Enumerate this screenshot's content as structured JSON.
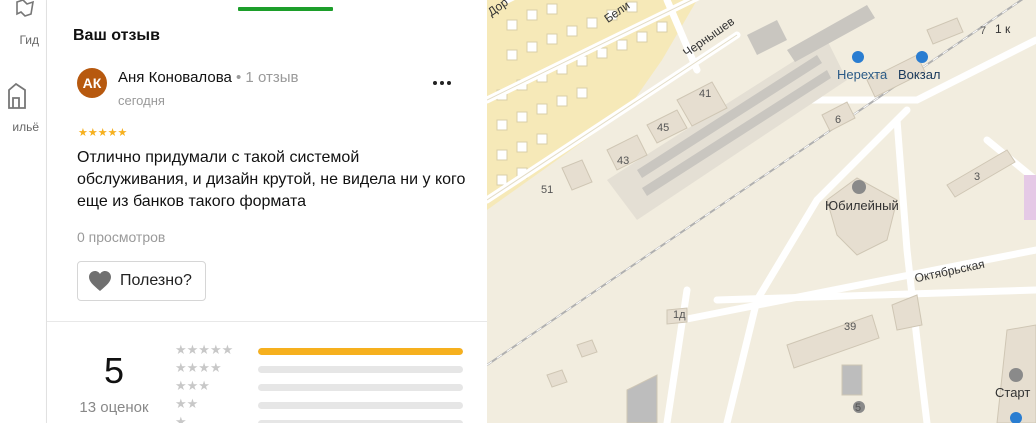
{
  "rail": {
    "items": [
      {
        "label": "Гид",
        "icon": "guide-icon"
      },
      {
        "label": "ильё",
        "icon": "housing-icon"
      }
    ]
  },
  "review": {
    "section_title": "Ваш отзыв",
    "avatar_initials": "АК",
    "avatar_color": "#b7590f",
    "author_name": "Аня Коновалова",
    "author_meta": " • 1 отзыв",
    "date": "сегодня",
    "stars": "★★★★★",
    "rating": 5,
    "text": "Отлично придумали с такой системой обслуживания, и дизайн крутой, не видела ни у кого еще из банков такого формата",
    "views": "0 просмотров",
    "helpful_label": "Полезно?",
    "menu_icon": "more-dots-icon"
  },
  "summary": {
    "average": "5",
    "count": "13 оценок",
    "distribution": [
      {
        "stars": "★★★★★",
        "fraction": 1.0
      },
      {
        "stars": "★★★★",
        "fraction": 0.0
      },
      {
        "stars": "★★★",
        "fraction": 0.0
      },
      {
        "stars": "★★",
        "fraction": 0.0
      },
      {
        "stars": "★",
        "fraction": 0.0
      }
    ]
  },
  "colors": {
    "accent_green": "#1c9e2a",
    "star_yellow": "#f6b01e",
    "map_bg": "#f2eddf"
  },
  "map": {
    "streets": {
      "belinskogo": "Бели",
      "chernyshevskogo": "Чернышев",
      "oktyabrskaya": "Октябрьская",
      "do": "Дор",
      "one_k": "1 к"
    },
    "places": {
      "nerekhta": "Нерехта",
      "vokzal": "Вокзал",
      "yubileyny": "Юбилейный",
      "start": "Старт"
    },
    "house_numbers": [
      "41",
      "45",
      "43",
      "51",
      "6",
      "7",
      "3",
      "1д",
      "39",
      "5"
    ]
  }
}
